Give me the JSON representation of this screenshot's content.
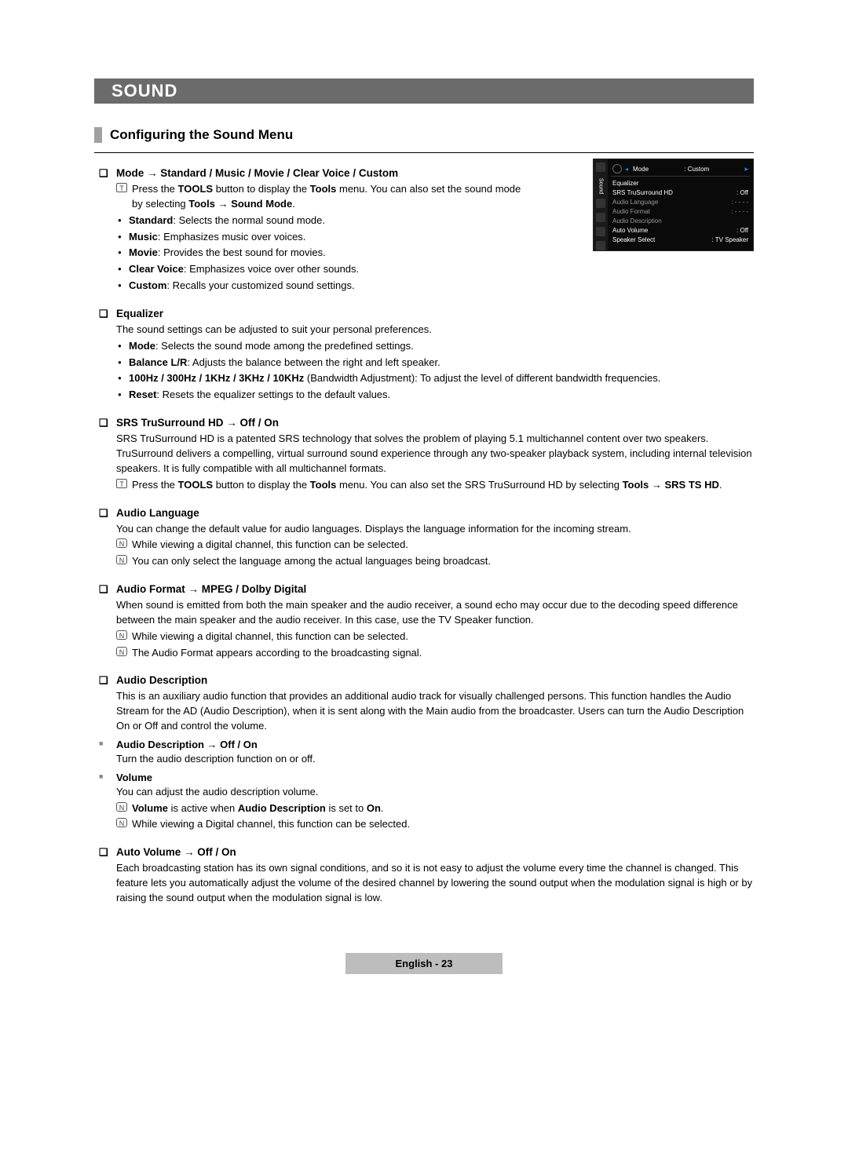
{
  "chapter": "SOUND",
  "section": "Configuring the Sound Menu",
  "footer": "English - 23",
  "osd": {
    "tab": "Sound",
    "head_label": "Mode",
    "head_value": "Custom",
    "rows": [
      {
        "l": "Equalizer",
        "v": ""
      },
      {
        "l": "SRS TruSurround HD",
        "v": ": Off"
      },
      {
        "l": "Audio Language",
        "v": ": - - - -"
      },
      {
        "l": "Audio Format",
        "v": ": - - - -"
      },
      {
        "l": "Audio Description",
        "v": ""
      },
      {
        "l": "Auto Volume",
        "v": ": Off"
      },
      {
        "l": "Speaker Select",
        "v": ": TV Speaker"
      }
    ]
  },
  "s1": {
    "title": "Mode → Standard / Music / Movie / Clear Voice / Custom",
    "tip_pre": "Press the ",
    "tip_b1": "TOOLS",
    "tip_mid": " button to display the ",
    "tip_b2": "Tools",
    "tip_mid2": " menu. You can also set the sound mode by selecting ",
    "tip_b3": "Tools → Sound Mode",
    "tip_end": ".",
    "i1b": "Standard",
    "i1": ": Selects the normal sound mode.",
    "i2b": "Music",
    "i2": ": Emphasizes music over voices.",
    "i3b": "Movie",
    "i3": ": Provides the best sound for movies.",
    "i4b": "Clear Voice",
    "i4": ": Emphasizes voice over other sounds.",
    "i5b": "Custom",
    "i5": ": Recalls your customized sound settings."
  },
  "s2": {
    "title": "Equalizer",
    "p": "The sound settings can be adjusted to suit your personal preferences.",
    "i1b": "Mode",
    "i1": ": Selects the sound mode among the predefined settings.",
    "i2b": "Balance L/R",
    "i2": ": Adjusts the balance between the right and left speaker.",
    "i3b": "100Hz / 300Hz / 1KHz / 3KHz / 10KHz",
    "i3": " (Bandwidth Adjustment): To adjust the level of different bandwidth frequencies.",
    "i4b": "Reset",
    "i4": ": Resets the equalizer settings to the default values."
  },
  "s3": {
    "title": "SRS TruSurround HD → Off / On",
    "p": "SRS TruSurround HD is a patented SRS technology that solves the problem of playing 5.1 multichannel content over two speakers. TruSurround delivers a compelling, virtual surround sound experience through any two-speaker playback system, including internal television speakers. It is fully compatible with all multichannel formats.",
    "tip_pre": "Press the ",
    "tip_b1": "TOOLS",
    "tip_mid": " button to display the ",
    "tip_b2": "Tools",
    "tip_mid2": " menu. You can also set the SRS TruSurround HD by selecting ",
    "tip_b3": "Tools → SRS TS HD",
    "tip_end": "."
  },
  "s4": {
    "title": "Audio Language",
    "p": "You can change the default value for audio languages. Displays the language information for the incoming stream.",
    "n1": "While viewing a digital channel, this function can be selected.",
    "n2": "You can only select the language among the actual languages being broadcast."
  },
  "s5": {
    "title": "Audio Format → MPEG / Dolby Digital",
    "p": "When sound is emitted from both the main speaker and the audio receiver, a sound echo may occur due to the decoding speed difference between the main speaker and the audio receiver. In this case, use the TV Speaker function.",
    "n1": "While viewing a digital channel, this function can be selected.",
    "n2": "The Audio Format appears according to the broadcasting signal."
  },
  "s6": {
    "title": "Audio Description",
    "p": "This is an auxiliary audio function that provides an additional audio track for visually challenged persons. This function handles the Audio Stream for the AD (Audio Description), when it is sent along with the Main audio from the broadcaster. Users can turn the Audio Description On or Off and control the volume.",
    "sub1": "Audio Description → Off / On",
    "sub1p": "Turn the audio description function on or off.",
    "sub2": "Volume",
    "sub2p": "You can adjust the audio description volume.",
    "sub2n1a": "Volume",
    "sub2n1b": " is active when ",
    "sub2n1c": "Audio Description",
    "sub2n1d": " is set to ",
    "sub2n1e": "On",
    "sub2n1f": ".",
    "sub2n2": "While viewing a Digital channel, this function can be selected."
  },
  "s7": {
    "title": "Auto Volume → Off / On",
    "p": "Each broadcasting station has its own signal conditions, and so it is not easy to adjust the volume every time the channel is changed. This feature lets you automatically adjust the volume of the desired channel by lowering the sound output when the modulation signal is high or by raising the sound output when the modulation signal is low."
  }
}
